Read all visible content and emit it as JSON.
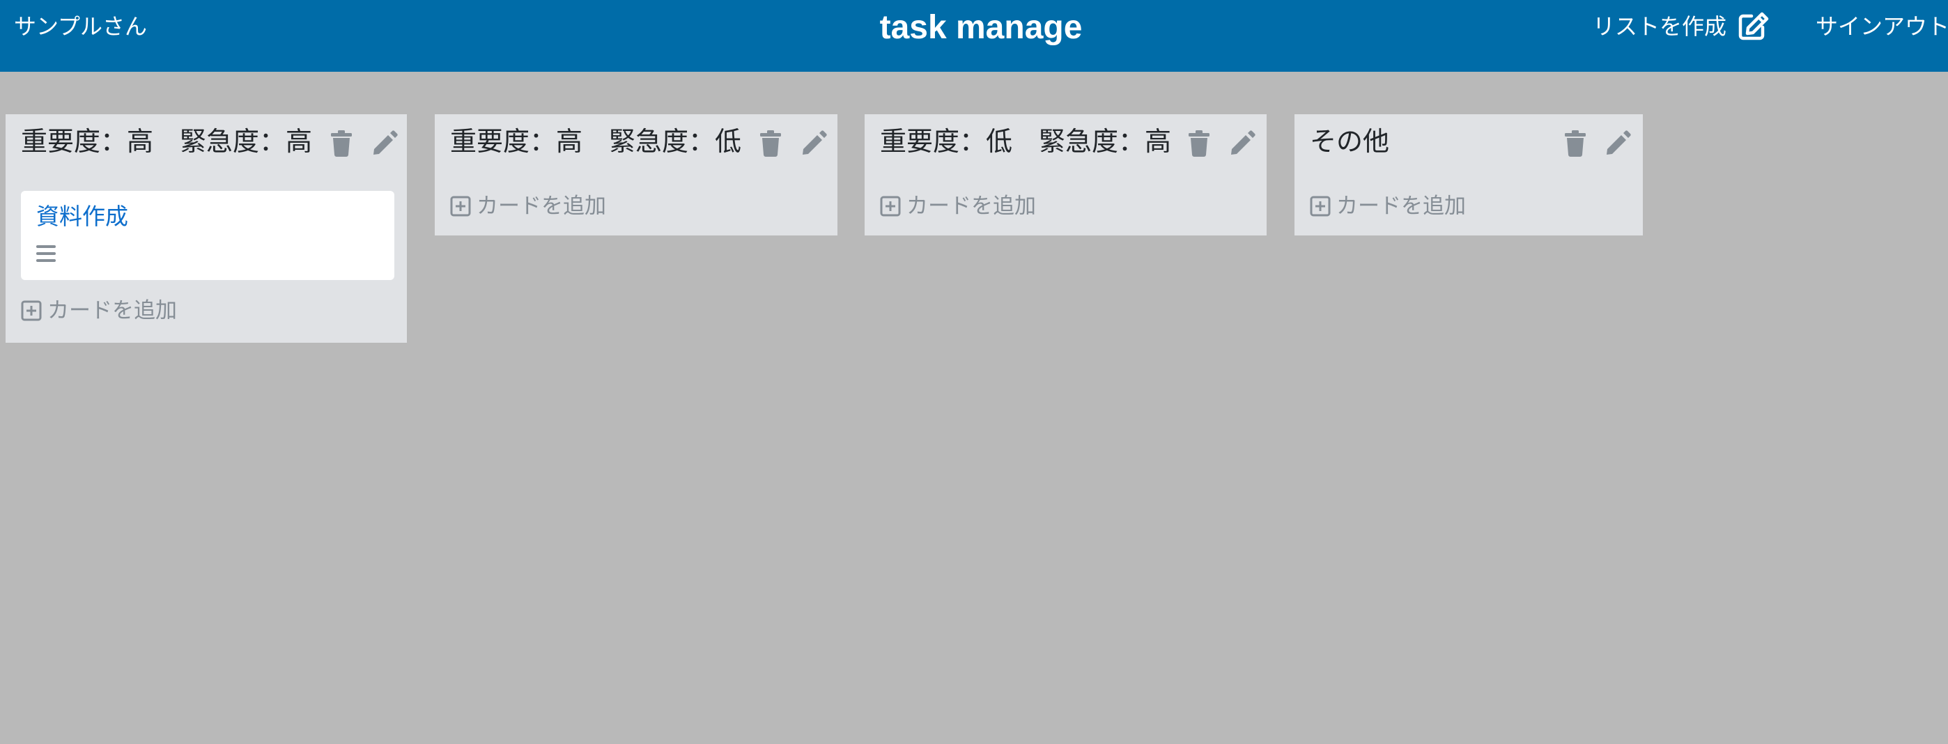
{
  "header": {
    "user": "サンプルさん",
    "title": "task manage",
    "create_list": "リストを作成",
    "sign_out": "サインアウト"
  },
  "lists": [
    {
      "title": "重要度：高　緊急度：高",
      "cards": [
        {
          "title": "資料作成"
        }
      ],
      "add_card": "カードを追加"
    },
    {
      "title": "重要度：高　緊急度：低",
      "cards": [],
      "add_card": "カードを追加"
    },
    {
      "title": "重要度：低　緊急度：高",
      "cards": [],
      "add_card": "カードを追加"
    },
    {
      "title": "その他",
      "cards": [],
      "add_card": "カードを追加"
    }
  ],
  "icons": {
    "create": "edit-square-icon",
    "delete": "trash-icon",
    "edit": "pencil-icon",
    "add": "plus-square-icon",
    "card_menu": "bars-icon"
  },
  "colors": {
    "navbar": "#006ca8",
    "background": "#b9b9b9",
    "list": "#e0e2e5",
    "card_link": "#0d6ecc",
    "muted": "#868e96"
  }
}
